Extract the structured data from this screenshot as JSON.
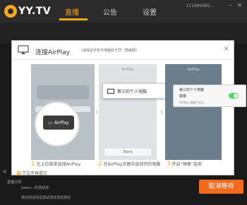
{
  "app": {
    "logo": "YY.TV",
    "tabs": [
      {
        "label": "直播"
      },
      {
        "label": "公告"
      },
      {
        "label": "设置"
      }
    ],
    "user_id": "111695681…"
  },
  "modal": {
    "title": "连接AirPlay",
    "subtitle": "（请保证手机与电脑处于同一局域网）",
    "close": "×",
    "steps": [
      {
        "num": "1",
        "caption": "在上拉菜单选择AirPlay",
        "airplay": "AirPlay"
      },
      {
        "num": "2",
        "caption": "在AirPlay页面中选择你的电脑",
        "header": "AirPlay",
        "popup": "第三的个人电脑",
        "done": "Done"
      },
      {
        "num": "3",
        "caption": "开启“镜像”选项",
        "header": "AirPlay",
        "device": "第三的个人电脑",
        "mirror": "镜像",
        "note": "AirPlay 镜像打开后 …"
      }
    ],
    "dont_show": "下次不再提示"
  },
  "bottom": {
    "line1": "直播分类：",
    "line2": "pears…的测试流",
    "line3": "测试测试测试测试测试测试测试",
    "cancel": "取消等待"
  }
}
